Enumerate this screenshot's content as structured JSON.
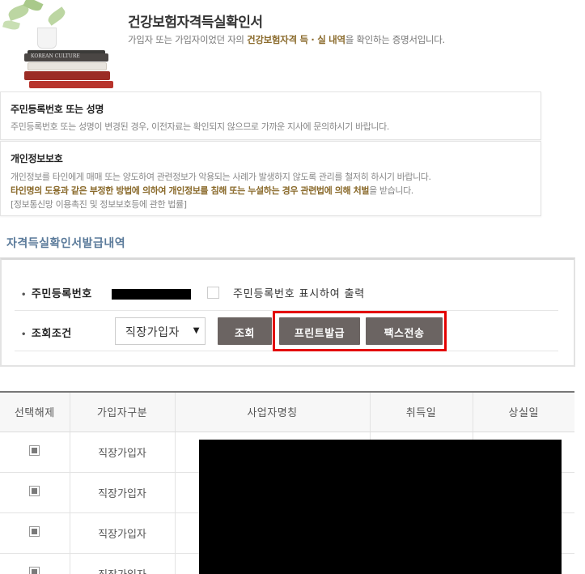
{
  "header": {
    "title": "건강보험자격득실확인서",
    "desc_prefix": "가입자 또는 가입자이었던 자의 ",
    "desc_highlight": "건강보험자격 득 · 실 내역",
    "desc_suffix": "을 확인하는 증명서입니다.",
    "book_text": "KOREAN CULTURE"
  },
  "notice1": {
    "title": "주민등록번호 또는 성명",
    "body": "주민등록번호 또는 성명이 변경된 경우, 이전자료는 확인되지 않으므로 가까운 지사에 문의하시기 바랍니다."
  },
  "notice2": {
    "title": "개인정보보호",
    "line1": "개인정보를 타인에게 매매 또는 양도하여 관련정보가 악용되는 사례가 발생하지 않도록 관리를 철저히 하시기 바랍니다.",
    "line2_bold": "타인명의 도용과 같은 부정한 방법에 의하여 개인정보를 침해 또는 누설하는 경우 관련법에 의해 처벌",
    "line2_tail": "을 받습니다.",
    "line3": "[정보통신망 이용촉진 및 정보보호등에 관한 법률]"
  },
  "section_title": "자격득실확인서발급내역",
  "query": {
    "rrn_label": "주민등록번호",
    "rrn_checkbox_label": "주민등록번호 표시하여 출력",
    "cond_label": "조회조건",
    "select_value": "직장가입자",
    "search_button": "조회",
    "print_button": "프린트발급",
    "fax_button": "팩스전송"
  },
  "table": {
    "headers": [
      "선택해제",
      "가입자구분",
      "사업자명칭",
      "취득일",
      "상실일"
    ],
    "rows": [
      {
        "type": "직장가입자"
      },
      {
        "type": "직장가입자"
      },
      {
        "type": "직장가입자"
      },
      {
        "type": "직장가입자"
      }
    ]
  },
  "colors": {
    "accent_brown": "#8a6a2b",
    "button_bg": "#6b6462",
    "highlight_frame": "#e30000",
    "section_title": "#5a7a9a"
  }
}
